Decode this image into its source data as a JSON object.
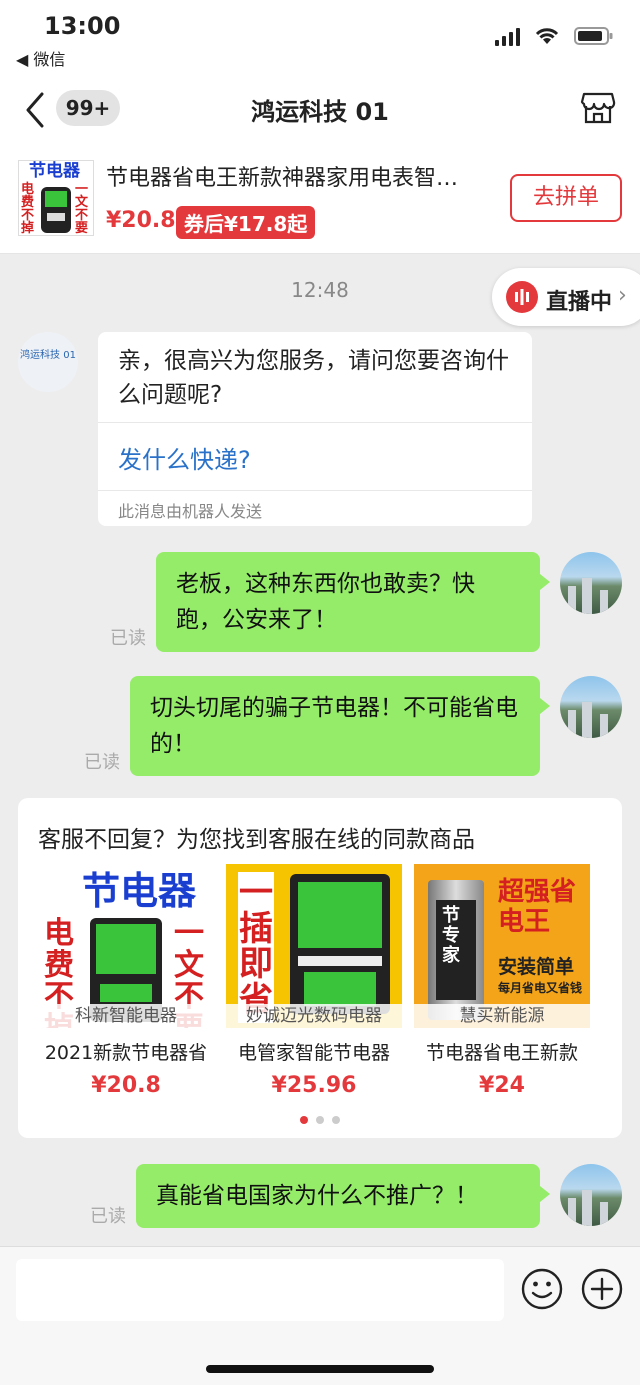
{
  "status_bar": {
    "time": "13:00",
    "back_app": "◀ 微信"
  },
  "nav": {
    "unread": "99+",
    "title": "鸿运科技 01"
  },
  "product": {
    "thumb_top": "节电器",
    "thumb_left": "电费不掉",
    "thumb_right": "一文不要",
    "title": "节电器省电王新款神器家用电表智…",
    "price": "¥20.8",
    "coupon": "券后¥17.8起",
    "action": "去拼单"
  },
  "chat": {
    "timestamp": "12:48",
    "live": {
      "label": "直播中",
      "chevron": "›"
    },
    "shop_avatar_text": "鸿运科技 01",
    "bot_message": {
      "text": "亲，很高兴为您服务，请问您要咨询什么问题呢?",
      "quick_reply": "发什么快递?",
      "note": "此消息由机器人发送"
    },
    "messages": [
      {
        "text": "老板，这种东西你也敢卖？快跑，公安来了！",
        "status": "已读"
      },
      {
        "text": "切头切尾的骗子节电器！不可能省电的！",
        "status": "已读"
      },
      {
        "text": "真能省电国家为什么不推广？！",
        "status": "已读"
      }
    ]
  },
  "recommend": {
    "title": "客服不回复？为您找到客服在线的同款商品",
    "items": [
      {
        "shop": "科新智能电器",
        "name": "2021新款节电器省",
        "price": "¥20.8",
        "art": [
          "节电器",
          "电费不掉",
          "一文不要"
        ]
      },
      {
        "shop": "妙诚迈光数码电器",
        "name": "电管家智能节电器",
        "price": "¥25.96",
        "art": [
          "一插即省"
        ]
      },
      {
        "shop": "慧买新能源",
        "name": "节电器省电王新款",
        "price": "¥24",
        "art": [
          "超强省电王",
          "安装简单",
          "每月省电又省钱",
          "节专家"
        ]
      }
    ]
  },
  "colors": {
    "accent": "#e4393c",
    "bubble": "#95ec69",
    "link": "#2a72c9"
  }
}
